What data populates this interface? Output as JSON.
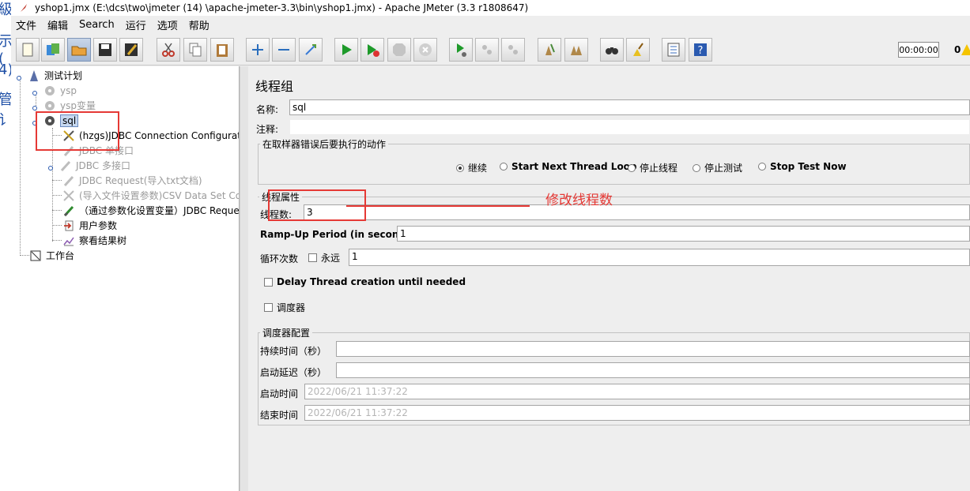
{
  "bleed": [
    "級",
    "示(",
    "4)",
    "管讠"
  ],
  "window": {
    "title": "yshop1.jmx (E:\\dcs\\two\\jmeter  (14)  \\apache-jmeter-3.3\\bin\\yshop1.jmx) - Apache JMeter (3.3 r1808647)"
  },
  "menu": [
    "文件",
    "编辑",
    "Search",
    "运行",
    "选项",
    "帮助"
  ],
  "toolbar": {
    "timer": "00:00:00",
    "count": "0"
  },
  "tree": {
    "root": "测试计划",
    "ysp": "ysp",
    "ysp_var": "ysp变量",
    "sql": "sql",
    "jdbc_conn": "(hzgs)JDBC Connection Configuratio",
    "jdbc_single": "JDBC 单接口",
    "jdbc_multi": "JDBC 多接口",
    "jdbc_request_txt": "JDBC Request(导入txt文档)",
    "csv": "(导入文件设置参数)CSV Data Set Cor",
    "jdbc_param": "（通过参数化设置变量）JDBC Reque",
    "user_params": "用户参数",
    "result_tree": "察看结果树",
    "workbench": "工作台"
  },
  "panel": {
    "title": "线程组",
    "name_label": "名称:",
    "name_value": "sql",
    "comment_label": "注释:",
    "comment_value": "",
    "error_group": "在取样器错误后要执行的动作",
    "error_options": [
      "继续",
      "Start Next Thread Loop",
      "停止线程",
      "停止测试",
      "Stop Test Now"
    ],
    "error_selected": 0,
    "thread_group": "线程属性",
    "threads_label": "线程数:",
    "threads_value": "3",
    "rampup_label": "Ramp-Up Period (in seconds):",
    "rampup_value": "1",
    "loop_label": "循环次数",
    "forever_label": "永远",
    "loop_value": "1",
    "delay_label": "Delay Thread creation until needed",
    "scheduler_label": "调度器",
    "sched_group": "调度器配置",
    "duration_label": "持续时间（秒）",
    "duration_value": "",
    "startup_delay_label": "启动延迟（秒）",
    "startup_delay_value": "",
    "start_time_label": "启动时间",
    "start_time_value": "2022/06/21 11:37:22",
    "end_time_label": "结束时间",
    "end_time_value": "2022/06/21 11:37:22"
  },
  "annotation": {
    "text": "修改线程数",
    "color": "#e53935"
  }
}
